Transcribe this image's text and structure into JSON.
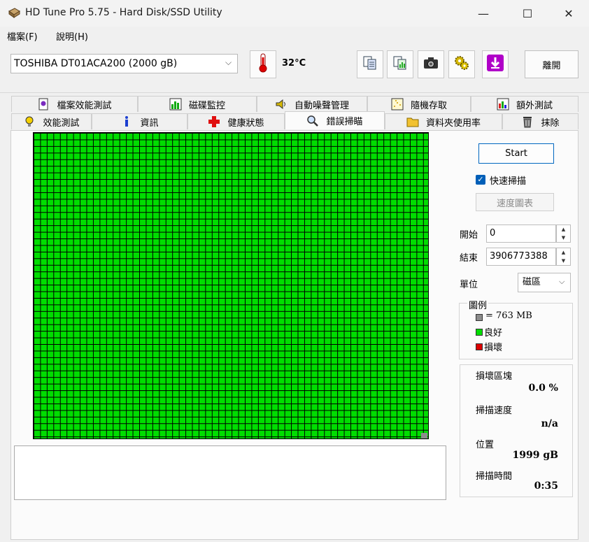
{
  "window": {
    "title": "HD Tune Pro 5.75 - Hard Disk/SSD Utility",
    "minimize": "—",
    "maximize": "☐",
    "close": "✕"
  },
  "menu": {
    "file": "檔案(F)",
    "help": "說明(H)"
  },
  "toolbar": {
    "drive": "TOSHIBA DT01ACA200 (2000 gB)",
    "temperature": "32°C",
    "exit_label": "離開"
  },
  "tabs": {
    "row1": [
      "檔案效能測試",
      "磁碟監控",
      "自動噪聲管理",
      "隨機存取",
      "額外測試"
    ],
    "row2": [
      "效能測試",
      "資訊",
      "健康狀態",
      "錯誤掃瞄",
      "資料夾使用率",
      "抹除"
    ]
  },
  "controls": {
    "start_label": "Start",
    "quick_scan_label": "快速掃描",
    "quick_scan_checked": true,
    "speed_map_label": "速度圖表",
    "start_field_label": "開始",
    "start_value": "0",
    "end_field_label": "結束",
    "end_value": "3906773388",
    "unit_label": "單位",
    "unit_value": "磁區"
  },
  "legend": {
    "title": "圖例",
    "block_size": "= 763 MB",
    "good": "良好",
    "damaged": "損壞",
    "colors": {
      "block": "#8c8c8c",
      "good": "#00dd00",
      "damaged": "#dd0000"
    }
  },
  "stats": {
    "damaged_blocks_label": "損壞區塊",
    "damaged_blocks_value": "0.0 %",
    "scan_speed_label": "掃描速度",
    "scan_speed_value": "n/a",
    "position_label": "位置",
    "position_value": "1999 gB",
    "scan_time_label": "掃描時間",
    "scan_time_value": "0:35"
  }
}
